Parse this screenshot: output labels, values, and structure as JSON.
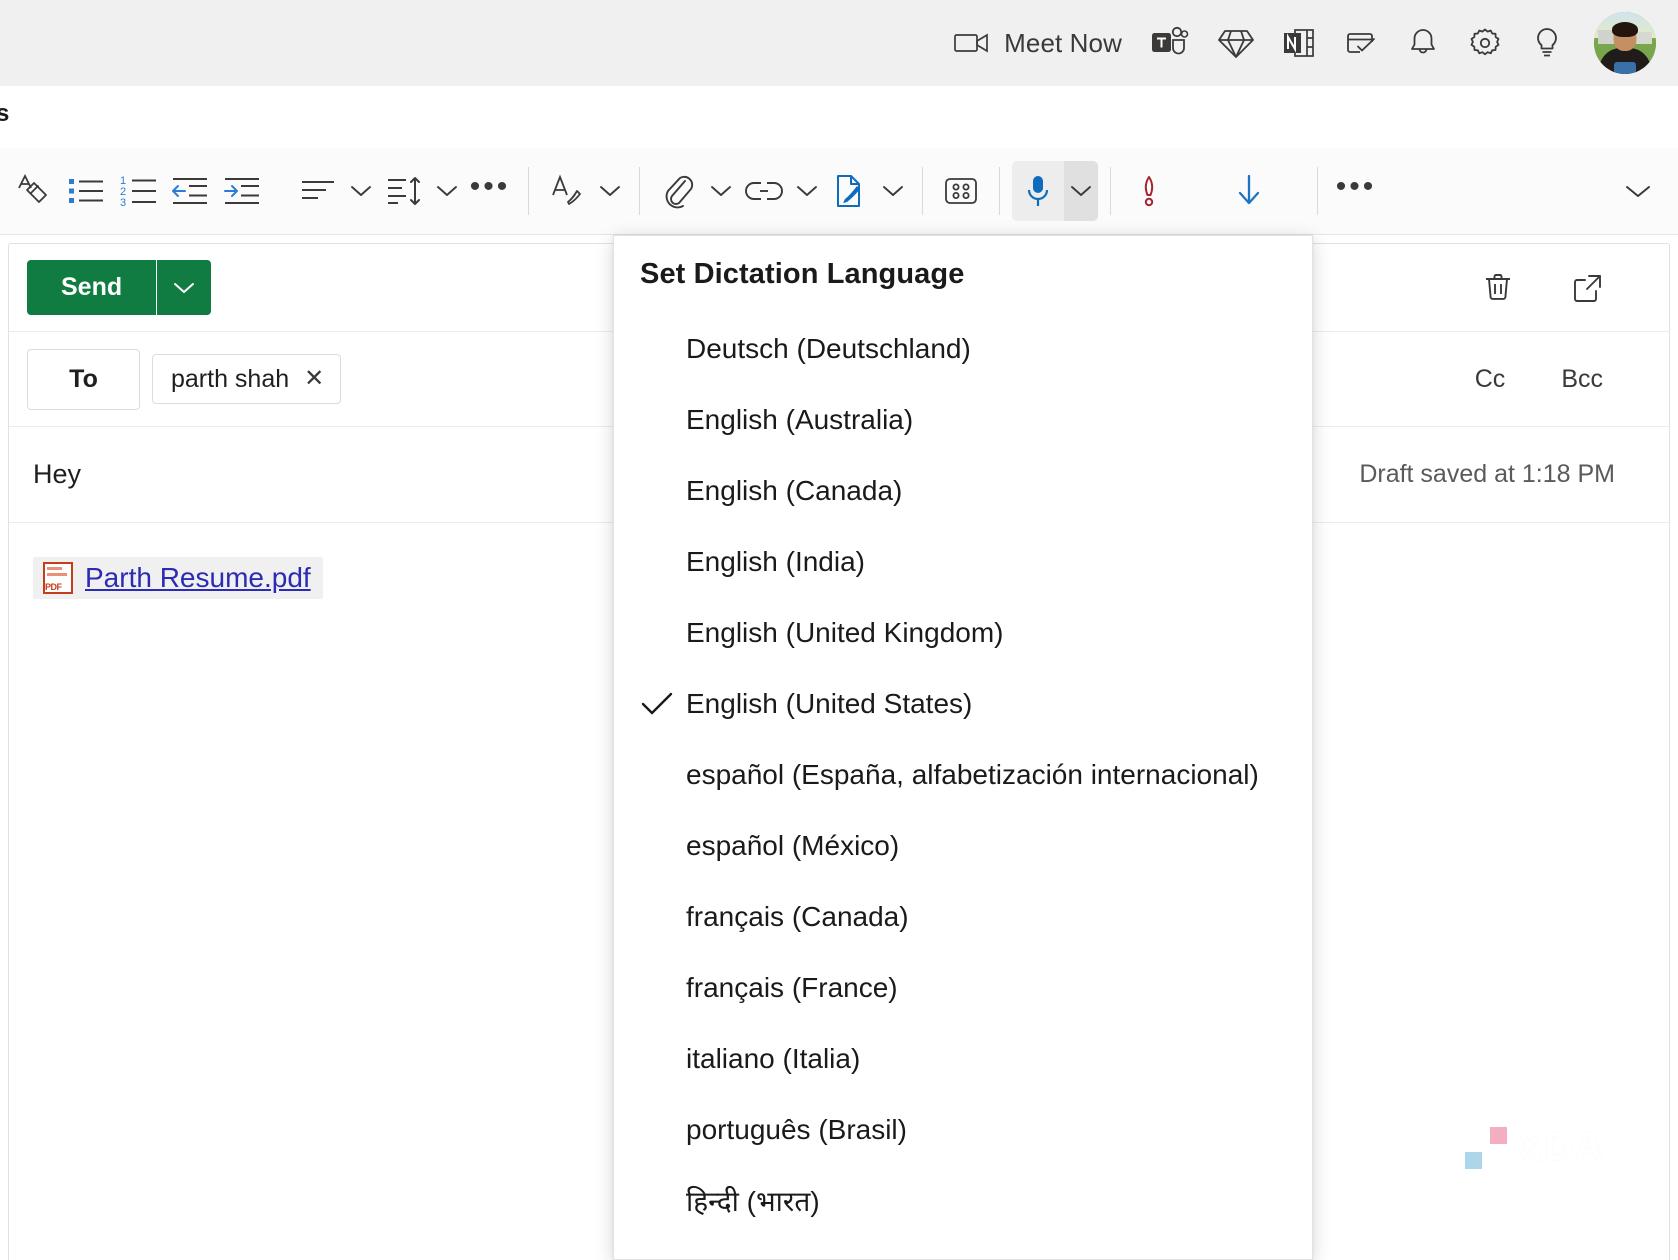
{
  "suite_bar": {
    "meet_now_label": "Meet Now",
    "items": [
      {
        "name": "camera-icon",
        "label": "Meet Now"
      },
      {
        "name": "teams-icon",
        "label": "Teams"
      },
      {
        "name": "diamond-icon",
        "label": "Premium"
      },
      {
        "name": "onenote-icon",
        "label": "OneNote"
      },
      {
        "name": "todo-icon",
        "label": "To Do"
      },
      {
        "name": "bell-icon",
        "label": "Notifications"
      },
      {
        "name": "gear-icon",
        "label": "Settings"
      },
      {
        "name": "lightbulb-icon",
        "label": "Tips"
      },
      {
        "name": "avatar",
        "label": "Account"
      }
    ]
  },
  "sub_strip": {
    "glyph": "s"
  },
  "format_toolbar": {
    "items": [
      {
        "name": "clear-formatting-icon",
        "label": "Clear formatting"
      },
      {
        "name": "bulleted-list-icon",
        "label": "Bulleted list"
      },
      {
        "name": "numbered-list-icon",
        "label": "Numbered list"
      },
      {
        "name": "decrease-indent-icon",
        "label": "Decrease indent"
      },
      {
        "name": "increase-indent-icon",
        "label": "Increase indent"
      },
      {
        "name": "align-icon",
        "label": "Align"
      },
      {
        "name": "line-spacing-icon",
        "label": "Line spacing"
      },
      {
        "name": "more-formatting-icon",
        "label": "More formatting options"
      },
      {
        "name": "signature-icon",
        "label": "Insert signature"
      },
      {
        "name": "attach-icon",
        "label": "Attach file"
      },
      {
        "name": "link-icon",
        "label": "Insert link"
      },
      {
        "name": "draft-with-copilot-icon",
        "label": "Draft with Copilot"
      },
      {
        "name": "apps-icon",
        "label": "Apps"
      },
      {
        "name": "dictate-icon",
        "label": "Dictate"
      },
      {
        "name": "importance-icon",
        "label": "Set importance"
      },
      {
        "name": "download-icon",
        "label": "Download"
      },
      {
        "name": "more-options-icon",
        "label": "More options"
      },
      {
        "name": "collapse-ribbon-icon",
        "label": "Collapse ribbon"
      }
    ],
    "ellipsis": "•••"
  },
  "compose": {
    "send_label": "Send",
    "send_caret_label": "Send options",
    "to_label": "To",
    "recipient": "parth shah",
    "recipient_remove": "✕",
    "cc_label": "Cc",
    "bcc_label": "Bcc",
    "subject": "Hey",
    "draft_status": "Draft saved at 1:18 PM",
    "discard_label": "Discard",
    "popout_label": "Open in new window",
    "attachment": {
      "file_name": "Parth Resume.pdf",
      "icon_label": "PDF",
      "icon_color": "#c43e1c"
    }
  },
  "dictation_menu": {
    "title": "Set Dictation Language",
    "selected": "English (United States)",
    "check_glyph": "✓",
    "languages": [
      {
        "label": "Deutsch (Deutschland)",
        "selected": false
      },
      {
        "label": "English (Australia)",
        "selected": false
      },
      {
        "label": "English (Canada)",
        "selected": false
      },
      {
        "label": "English (India)",
        "selected": false
      },
      {
        "label": "English (United Kingdom)",
        "selected": false
      },
      {
        "label": "English (United States)",
        "selected": true
      },
      {
        "label": "español (España, alfabetización internacional)",
        "selected": false
      },
      {
        "label": "español (México)",
        "selected": false
      },
      {
        "label": "français (Canada)",
        "selected": false
      },
      {
        "label": "français (France)",
        "selected": false
      },
      {
        "label": "italiano (Italia)",
        "selected": false
      },
      {
        "label": "português (Brasil)",
        "selected": false
      },
      {
        "label": "हिन्दी (भारत)",
        "selected": false
      }
    ]
  },
  "watermark": {
    "text": "XDA"
  },
  "colors": {
    "send_green": "#107c41",
    "accent_blue": "#0f6cbd",
    "link_blue": "#2b2bb5",
    "importance_red": "#a4262c",
    "suite_bar_bg": "#f0f0f0",
    "toolbar_bg": "#fbfbfb"
  }
}
